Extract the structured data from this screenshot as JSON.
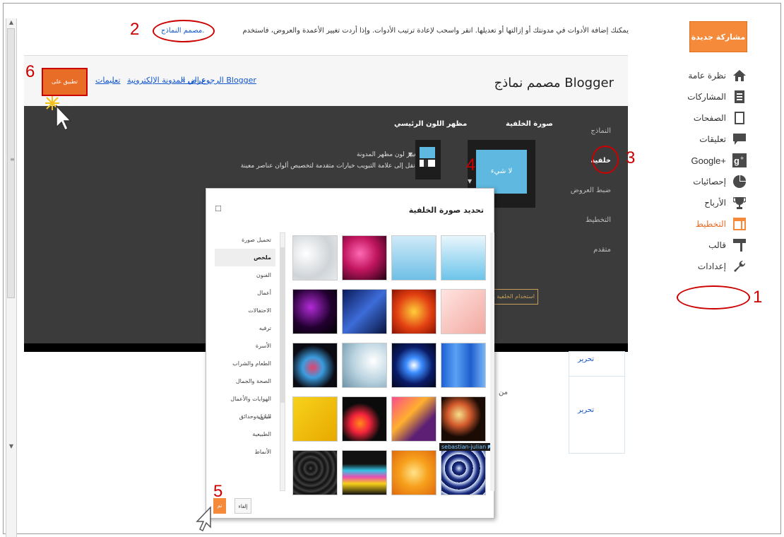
{
  "sidebar": {
    "new_post": "مشاركة جديدة",
    "items": [
      {
        "label": "نظرة عامة",
        "icon": "home-icon"
      },
      {
        "label": "المشاركات",
        "icon": "posts-icon"
      },
      {
        "label": "الصفحات",
        "icon": "pages-icon"
      },
      {
        "label": "تعليقات",
        "icon": "comments-icon"
      },
      {
        "label": "Google+",
        "icon": "google-plus-icon"
      },
      {
        "label": "إحصائيات",
        "icon": "stats-icon"
      },
      {
        "label": "الأرباح",
        "icon": "trophy-icon"
      },
      {
        "label": "التخطيط",
        "icon": "layout-icon"
      },
      {
        "label": "قالب",
        "icon": "template-icon"
      },
      {
        "label": "إعدادات",
        "icon": "wrench-icon"
      }
    ]
  },
  "intro": {
    "text": "يمكنك إضافة الأدوات في مدونتك أو إزالتها أو تعديلها. انقر واسحب لإعادة ترتيب الأدوات. وإذا أردت تغيير الأعمدة والعروض، فاستخدم",
    "link": "مصمم النماذج."
  },
  "designer": {
    "title": "مصمم نماذج Blogger",
    "apply": "تطبيق على المدونة",
    "links": [
      "« الرجوع إلى Blogger",
      "عرض المدونة الإلكترونية",
      "تعليمات"
    ],
    "menu": [
      "النماذج",
      "خلفية",
      "ضبط العروض",
      "التخطيط",
      "متقدم"
    ],
    "bg_title": "صورة الخلفية",
    "bg_none": "لا شيء",
    "color_title": "مظهر اللون الرئيسي",
    "color_desc1": "تغيير لون مظهر المدونة",
    "color_desc2": "انقل إلى علامة التبويب خيارات متقدمة لتخصيص ألوان عناصر معينة.",
    "use_bg": "استخدام الخلفية والألوان",
    "edit": "تحرير",
    "from": "من"
  },
  "dialog": {
    "title": "تحديد صورة الخلفية",
    "categories": [
      "تحميل صورة",
      "ملخص",
      "الفنون",
      "أعمال",
      "الاحتفالات",
      "ترفيه",
      "الأسرة",
      "الطعام والشراب",
      "الصحة والجمال",
      "الهوايات والأعمال اليدوية",
      "منازل وحدائق",
      "الطبيعية",
      "الأنماط"
    ],
    "selected_category": "ملخص",
    "credit": "sebastian-julian",
    "done": "تم",
    "cancel": "إلغاء"
  },
  "annotations": [
    "1",
    "2",
    "3",
    "4",
    "5",
    "6"
  ],
  "colors": {
    "accent": "#f48a3a",
    "annotation": "#cc0000",
    "dark_panel": "#3b3b3b",
    "link": "#1155cc"
  }
}
